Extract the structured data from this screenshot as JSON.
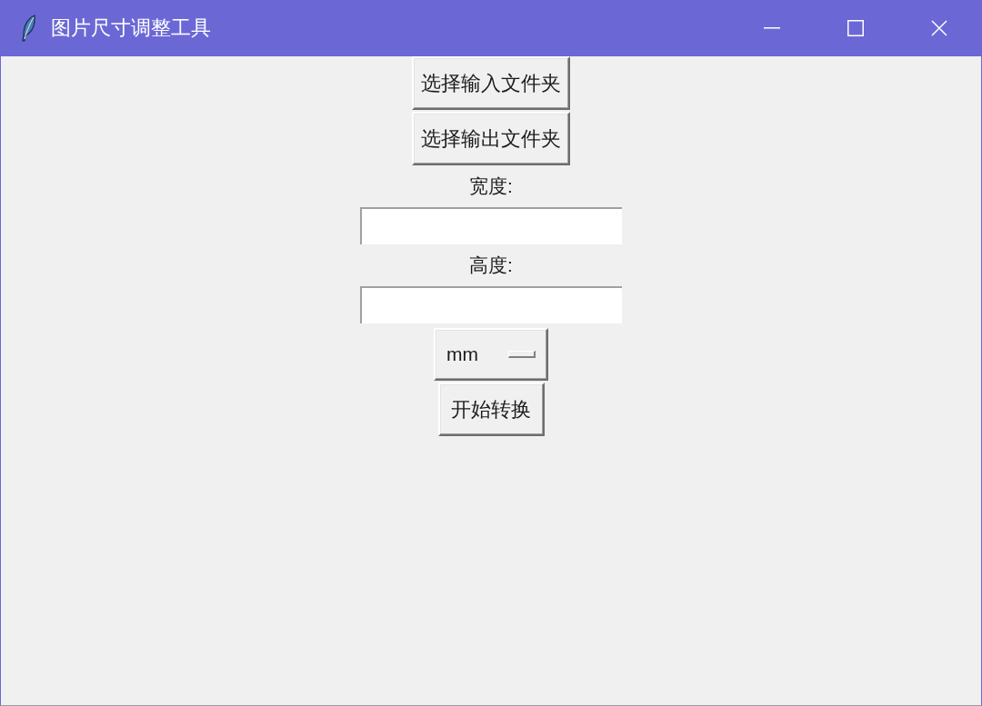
{
  "window": {
    "title": "图片尺寸调整工具"
  },
  "form": [
    {
      "kind": "button",
      "label": "选择输入文件夹"
    },
    {
      "kind": "button",
      "label": "选择输出文件夹"
    },
    {
      "kind": "field",
      "label": "宽度:"
    },
    {
      "kind": "field",
      "label": "高度:"
    },
    {
      "kind": "menu",
      "value": "mm"
    },
    {
      "kind": "button",
      "label": "开始转换"
    }
  ]
}
